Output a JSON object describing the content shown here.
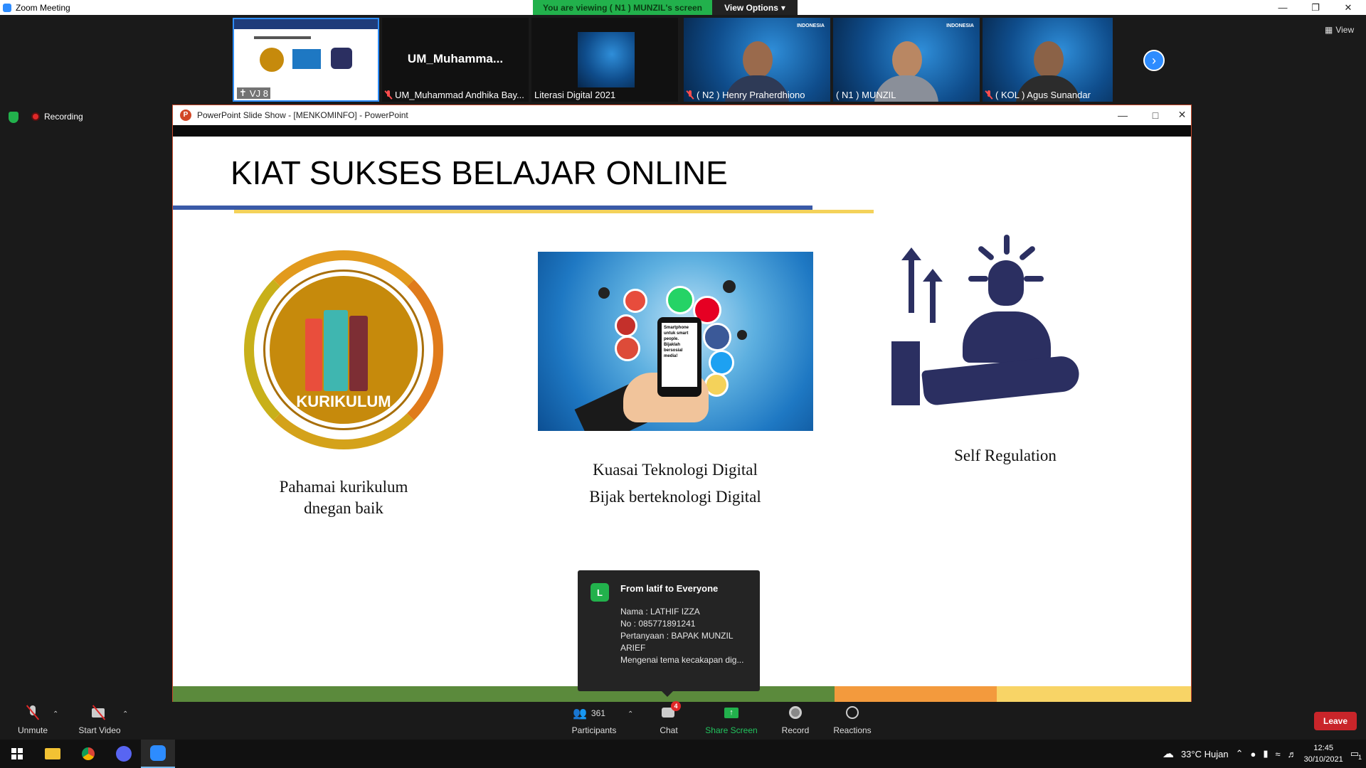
{
  "window": {
    "title": "Zoom Meeting"
  },
  "share_banner": {
    "text": "You are viewing ( N1 ) MUNZIL's screen",
    "view_options": "View Options"
  },
  "thumbnails": [
    {
      "label": "VJ 8"
    },
    {
      "name": "UM_Muhamma...",
      "label": "UM_Muhammad Andhika Bay..."
    },
    {
      "label": "Literasi Digital 2021"
    },
    {
      "label": "( N2 ) Henry Praherdhiono"
    },
    {
      "label": "( N1 ) MUNZIL"
    },
    {
      "label": "( KOL ) Agus Sunandar"
    }
  ],
  "view_button": "View",
  "recording": "Recording",
  "ppt": {
    "window_title": "PowerPoint Slide Show - [MENKOMINFO] - PowerPoint",
    "slide_title": "KIAT SUKSES BELAJAR ONLINE",
    "col1": {
      "badge": "KURIKULUM",
      "line1": "Pahamai kurikulum",
      "line2": "dnegan baik"
    },
    "col2": {
      "line1": "Kuasai Teknologi Digital",
      "line2": "Bijak berteknologi Digital",
      "phone_text": "Smartphone untuk smart people. Bijaklah bersosial media!"
    },
    "col3": {
      "line1": "Self Regulation"
    }
  },
  "chat_popup": {
    "avatar": "L",
    "from": "From latif to Everyone",
    "lines": [
      "Nama : LATHIF IZZA",
      "No : 085771891241",
      "Pertanyaan : BAPAK MUNZIL ARIEF",
      "Mengenai tema kecakapan dig..."
    ]
  },
  "toolbar": {
    "unmute": "Unmute",
    "start_video": "Start Video",
    "participants": "Participants",
    "participants_count": "361",
    "chat": "Chat",
    "chat_badge": "4",
    "share_screen": "Share Screen",
    "record": "Record",
    "reactions": "Reactions",
    "leave": "Leave"
  },
  "taskbar": {
    "weather": "33°C  Hujan",
    "time": "12:45",
    "date": "30/10/2021",
    "notifications": "1"
  },
  "colors": {
    "zoom_blue": "#2d8cff",
    "banner_green": "#22b14c",
    "leave_red": "#c9252a",
    "slide_navy": "#2b2f61"
  }
}
